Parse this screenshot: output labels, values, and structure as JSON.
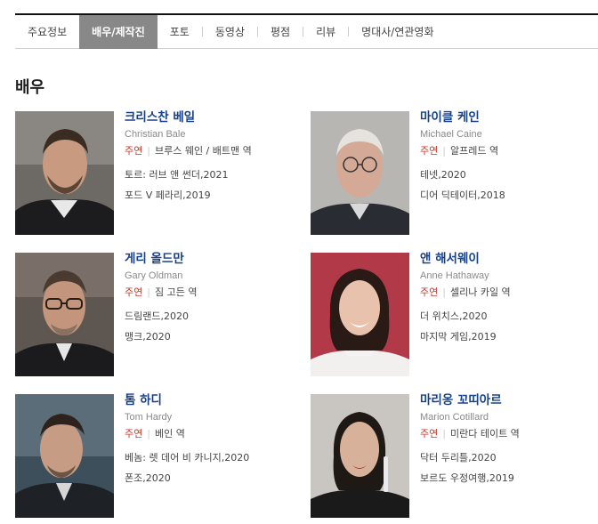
{
  "tabs": [
    {
      "label": "주요정보",
      "active": false
    },
    {
      "label": "배우/제작진",
      "active": true
    },
    {
      "label": "포토",
      "active": false
    },
    {
      "label": "동영상",
      "active": false
    },
    {
      "label": "평점",
      "active": false
    },
    {
      "label": "리뷰",
      "active": false
    },
    {
      "label": "명대사/연관영화",
      "active": false
    }
  ],
  "section_title": "배우",
  "actors": [
    {
      "name": "크리스찬 베일",
      "english_name": "Christian Bale",
      "role_type": "주연",
      "role": "브루스 웨인 / 배트맨 역",
      "films": [
        "토르: 러브 앤 썬더,2021",
        "포드 V 페라리,2019"
      ]
    },
    {
      "name": "마이클 케인",
      "english_name": "Michael Caine",
      "role_type": "주연",
      "role": "알프레드 역",
      "films": [
        "테넷,2020",
        "디어 딕테이터,2018"
      ]
    },
    {
      "name": "게리 올드만",
      "english_name": "Gary Oldman",
      "role_type": "주연",
      "role": "짐 고든 역",
      "films": [
        "드림랜드,2020",
        "맹크,2020"
      ]
    },
    {
      "name": "앤 해서웨이",
      "english_name": "Anne Hathaway",
      "role_type": "주연",
      "role": "셀리나 카일 역",
      "films": [
        "더 위치스,2020",
        "마지막 게임,2019"
      ]
    },
    {
      "name": "톰 하디",
      "english_name": "Tom Hardy",
      "role_type": "주연",
      "role": "베인 역",
      "films": [
        "베놈: 렛 데어 비 카니지,2020",
        "폰조,2020"
      ]
    },
    {
      "name": "마리옹 꼬띠아르",
      "english_name": "Marion Cotillard",
      "role_type": "주연",
      "role": "미란다 테이트 역",
      "films": [
        "닥터 두리틀,2020",
        "보르도 우정여행,2019"
      ]
    }
  ],
  "colors": {
    "active_tab": "#888888",
    "actor_name": "#16418a",
    "role_type": "#c0392b",
    "muted": "#8a8a8a"
  }
}
